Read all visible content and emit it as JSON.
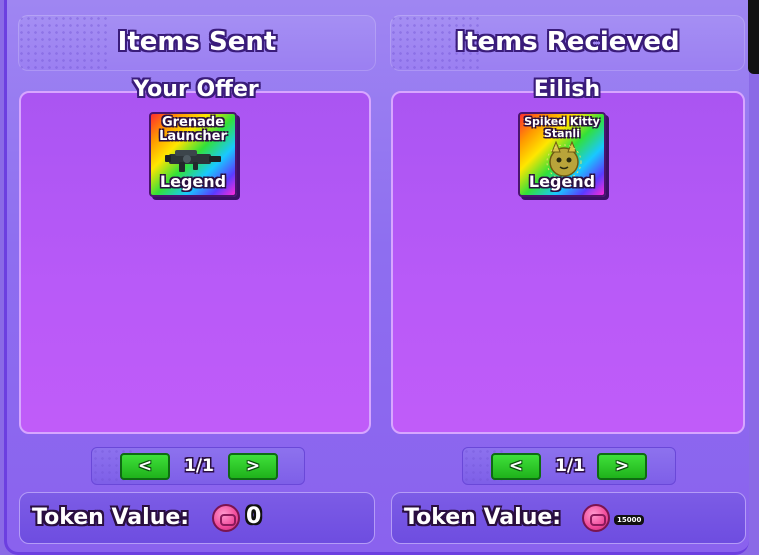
{
  "left": {
    "header": "Items Sent",
    "subtitle": "Your Offer",
    "items": [
      {
        "name": "Grenade Launcher",
        "rarity": "Legend",
        "icon": "grenade-launcher-icon"
      }
    ],
    "pager": {
      "prev": "<",
      "text": "1/1",
      "next": ">"
    },
    "token_label": "Token Value:",
    "token_value": "0"
  },
  "right": {
    "header": "Items Recieved",
    "subtitle": "Eilish",
    "items": [
      {
        "name": "Spiked Kitty Stanli",
        "rarity": "Legend",
        "icon": "spiked-kitty-icon"
      }
    ],
    "pager": {
      "prev": "<",
      "text": "1/1",
      "next": ">"
    },
    "token_label": "Token Value:",
    "token_value": "15000"
  },
  "colors": {
    "button_green": "#2ccb28",
    "panel_purple": "#b95af8",
    "background": "#8e6ef0"
  }
}
